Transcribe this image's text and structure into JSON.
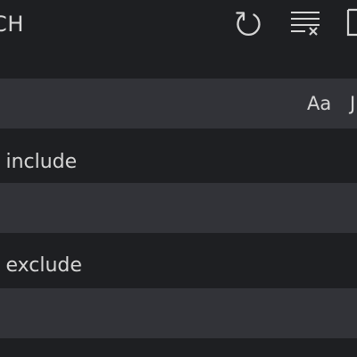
{
  "header": {
    "title": "CH",
    "icons": [
      "refresh-icon",
      "clear-results-icon",
      "new-search-editor-icon"
    ]
  },
  "search": {
    "value": "'",
    "match_case_label": "Aa",
    "whole_word_label": "J"
  },
  "include": {
    "label": "o include",
    "value": ""
  },
  "exclude": {
    "label": "o exclude",
    "value": ""
  },
  "colors": {
    "background": "#1e1f22",
    "input_background": "#323338",
    "text": "#d6d6d6"
  }
}
